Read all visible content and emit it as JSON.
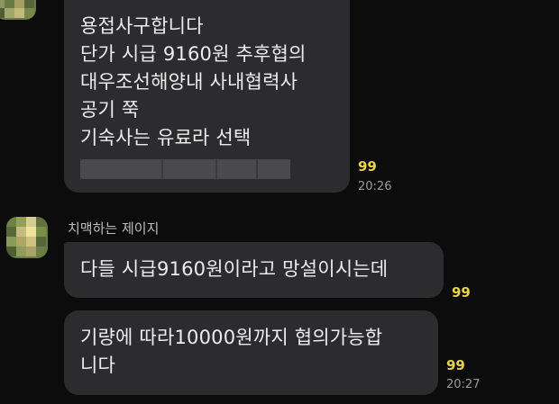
{
  "messages": [
    {
      "lines": [
        "용접사구합니다",
        "단가 시급 9160원 추후협의",
        "대우조선해양내 사내협력사",
        "공기 쭉",
        "기숙사는 유료라 선택"
      ],
      "unread": "99",
      "time": "20:26"
    },
    {
      "line": "다들 시급9160원이라고 망설이시는데",
      "unread": "99"
    },
    {
      "lines": [
        "기량에 따라10000원까지 협의가능합",
        "니다"
      ],
      "unread": "99",
      "time": "20:27"
    }
  ],
  "sender_name": "치맥하는 제이지",
  "colors": {
    "background": "#0c0c0c",
    "bubble": "#2c2c2e",
    "text": "#ececec",
    "unread": "#e7d34a",
    "time": "#9a9a9a"
  }
}
